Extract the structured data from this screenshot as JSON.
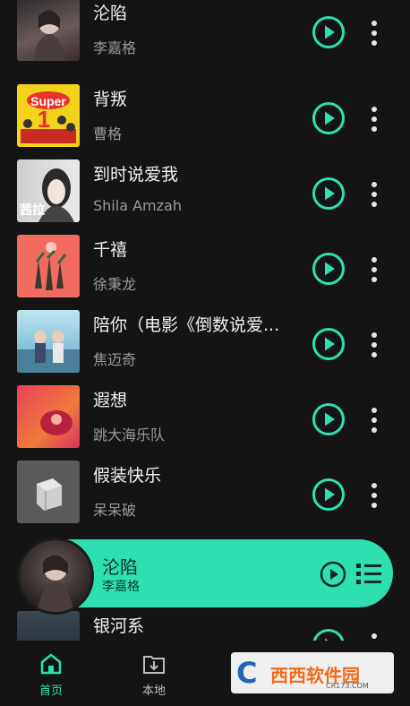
{
  "songs": [
    {
      "title": "沦陷",
      "artist": "李嘉格"
    },
    {
      "title": "背叛",
      "artist": "曹格"
    },
    {
      "title": "到时说爱我",
      "artist": "Shila Amzah",
      "cover_text": "茜拉"
    },
    {
      "title": "千禧",
      "artist": "徐秉龙"
    },
    {
      "title": "陪你（电影《倒数说爱...",
      "artist": "焦迈奇"
    },
    {
      "title": "遐想",
      "artist": "跳大海乐队"
    },
    {
      "title": "假装快乐",
      "artist": "呆呆破"
    },
    {
      "title": "银河系",
      "artist": ""
    }
  ],
  "now_playing": {
    "title": "沦陷",
    "artist": "李嘉格"
  },
  "nav": {
    "home_label": "首页",
    "local_label": "本地"
  },
  "watermark": {
    "logo": "C",
    "text": "西西软件园",
    "sub": "CR173.COM"
  },
  "colors": {
    "accent": "#2ee0b0",
    "background": "#141414"
  }
}
